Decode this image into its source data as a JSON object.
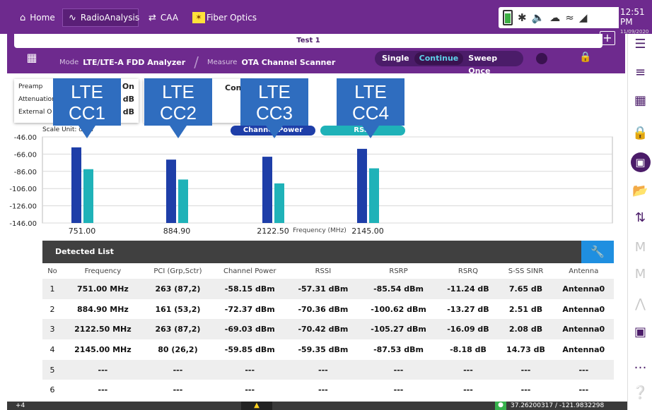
{
  "topbar": {
    "tabs": [
      {
        "label": "Home",
        "icon": "home-icon"
      },
      {
        "label": "RadioAnalysis",
        "icon": "pulse-icon"
      },
      {
        "label": "CAA",
        "icon": "caa-icon"
      },
      {
        "label": "Fiber Optics",
        "icon": "fiber-icon"
      }
    ],
    "time": "12:51 PM",
    "date": "11/09/2020"
  },
  "header": {
    "test_title": "Test 1",
    "mode_label": "Mode",
    "mode_value": "LTE/LTE-A FDD Analyzer",
    "measure_label": "Measure",
    "measure_value": "OTA Channel Scanner",
    "sweep_options": [
      "Single",
      "Continue",
      "Sweep Once"
    ],
    "sweep_active": "Continue"
  },
  "info_panel": {
    "preamp_label": "Preamp",
    "preamp_value": "On",
    "attenuation_label": "Attenuation",
    "attenuation_value": "0 dB",
    "external_label": "External O",
    "external_value": "0 dB",
    "second_box_label": "Con"
  },
  "callouts": [
    {
      "line1": "LTE",
      "line2": "CC1"
    },
    {
      "line1": "LTE",
      "line2": "CC2"
    },
    {
      "line1": "LTE",
      "line2": "CC3"
    },
    {
      "line1": "LTE",
      "line2": "CC4"
    }
  ],
  "legend": {
    "channel_power": "Channel Power",
    "rssi": "RSSI",
    "channel_power_color": "#1e3ea8",
    "rssi_color": "#1fb2b8"
  },
  "chart_data": {
    "type": "bar",
    "scale_unit_label": "Scale Unit: dBm",
    "xlabel": "Frequency (MHz)",
    "categories": [
      "751.00",
      "884.90",
      "2122.50",
      "2145.00"
    ],
    "yticks": [
      "-46.00",
      "-66.00",
      "-86.00",
      "-106.00",
      "-126.00",
      "-146.00"
    ],
    "ylim": [
      -146,
      -46
    ],
    "series": [
      {
        "name": "Channel Power",
        "values": [
          -58.15,
          -72.37,
          -69.03,
          -59.85
        ],
        "color": "#1e3ea8"
      },
      {
        "name": "RSSI",
        "values": [
          -83.5,
          -95.5,
          -100.0,
          -82.5
        ],
        "color": "#1fb2b8"
      }
    ]
  },
  "detected_list": {
    "title": "Detected List",
    "columns": [
      "No",
      "Frequency",
      "PCI (Grp,Sctr)",
      "Channel Power",
      "RSSI",
      "RSRP",
      "RSRQ",
      "S-SS SINR",
      "Antenna"
    ],
    "rows": [
      [
        "1",
        "751.00 MHz",
        "263 (87,2)",
        "-58.15 dBm",
        "-57.31 dBm",
        "-85.54 dBm",
        "-11.24 dB",
        "7.65 dB",
        "Antenna0"
      ],
      [
        "2",
        "884.90 MHz",
        "161 (53,2)",
        "-72.37 dBm",
        "-70.36 dBm",
        "-100.62 dBm",
        "-13.27 dB",
        "2.51 dB",
        "Antenna0"
      ],
      [
        "3",
        "2122.50 MHz",
        "263 (87,2)",
        "-69.03 dBm",
        "-70.42 dBm",
        "-105.27 dBm",
        "-16.09 dB",
        "2.08 dB",
        "Antenna0"
      ],
      [
        "4",
        "2145.00 MHz",
        "80 (26,2)",
        "-59.85 dBm",
        "-59.35 dBm",
        "-87.53 dBm",
        "-8.18 dB",
        "14.73 dB",
        "Antenna0"
      ],
      [
        "5",
        "---",
        "---",
        "---",
        "---",
        "---",
        "---",
        "---",
        "---"
      ],
      [
        "6",
        "---",
        "---",
        "---",
        "---",
        "---",
        "---",
        "---",
        "---"
      ]
    ]
  },
  "statusbar": {
    "left_text": "+4",
    "coordinates": "37.26200317 / -121.9832298"
  }
}
